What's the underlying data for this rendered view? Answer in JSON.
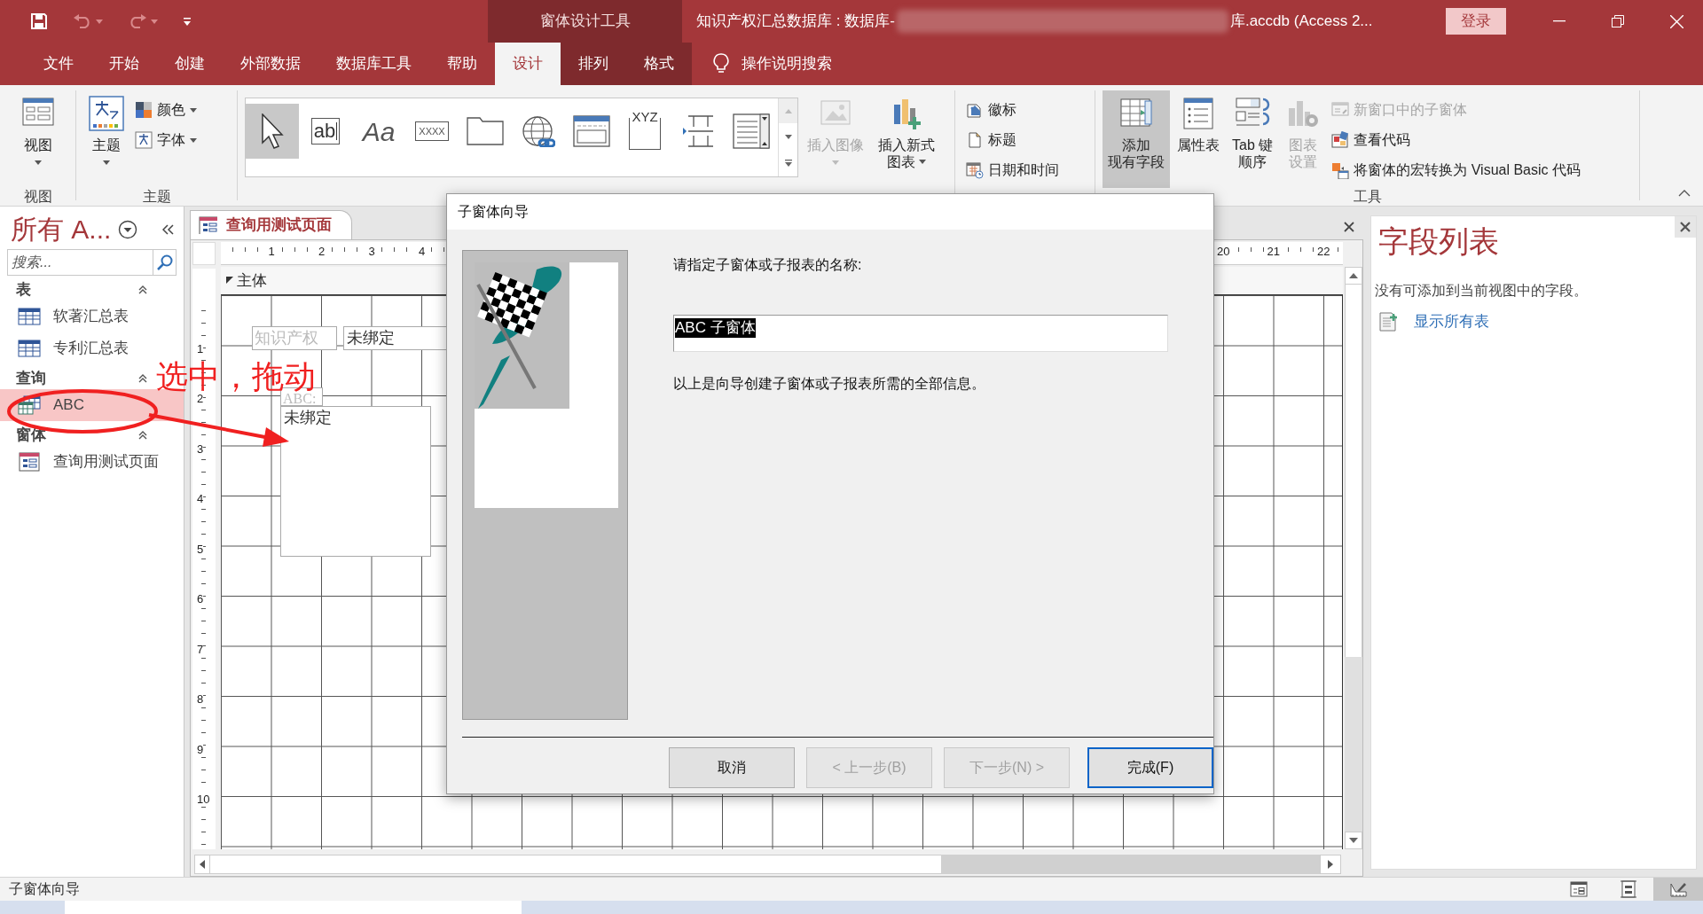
{
  "title_bar": {
    "context_group": "窗体设计工具",
    "title_start": "知识产权汇总数据库 : 数据库-",
    "title_end": "库.accdb (Access 2...",
    "sign_in": "登录"
  },
  "ribbon_tabs": [
    {
      "label": "文件",
      "selected": false
    },
    {
      "label": "开始",
      "selected": false
    },
    {
      "label": "创建",
      "selected": false
    },
    {
      "label": "外部数据",
      "selected": false
    },
    {
      "label": "数据库工具",
      "selected": false
    },
    {
      "label": "帮助",
      "selected": false
    },
    {
      "label": "设计",
      "selected": true
    },
    {
      "label": "排列",
      "selected": false
    },
    {
      "label": "格式",
      "selected": false
    }
  ],
  "tell_me": "操作说明搜索",
  "ribbon_groups": [
    {
      "label": "视图",
      "items": [
        {
          "kind": "large",
          "lines": [
            "视图"
          ],
          "dropdown": true,
          "disabled": false,
          "pressed": false
        }
      ]
    },
    {
      "label": "主题",
      "items": [
        {
          "kind": "large",
          "lines": [
            "主题"
          ],
          "dropdown": true,
          "disabled": false,
          "pressed": false
        },
        {
          "kind": "stack",
          "entries": [
            {
              "label": "颜色",
              "dropdown": true,
              "disabled": false
            },
            {
              "label": "字体",
              "dropdown": true,
              "disabled": false
            }
          ]
        }
      ]
    },
    {
      "items": [
        {
          "kind": "gallery",
          "entries": [
            {
              "selected": true
            },
            {
              "glyph": "ab",
              "selected": false
            },
            {
              "glyph": "Aa",
              "selected": false
            },
            {
              "glyph": "XXXX",
              "selected": false
            },
            {
              "selected": false
            },
            {
              "selected": false
            },
            {
              "selected": false
            },
            {
              "glyph": "XYZ",
              "selected": false
            },
            {
              "selected": false
            },
            {
              "selected": false
            }
          ]
        },
        {
          "kind": "large",
          "lines": [
            "插入图像"
          ],
          "dropdown": true,
          "disabled": true,
          "pressed": false
        },
        {
          "kind": "large",
          "lines": [
            "插入新式",
            "图表"
          ],
          "dropdown": true,
          "disabled": false,
          "pressed": false
        }
      ]
    },
    {
      "items": [
        {
          "kind": "stack",
          "entries": [
            {
              "label": "徽标",
              "dropdown": false,
              "disabled": false
            },
            {
              "label": "标题",
              "dropdown": false,
              "disabled": false
            },
            {
              "label": "日期和时间",
              "dropdown": false,
              "disabled": false
            }
          ]
        }
      ]
    },
    {
      "label": "工具",
      "items": [
        {
          "kind": "large",
          "lines": [
            "添加",
            "现有字段"
          ],
          "dropdown": false,
          "disabled": false,
          "pressed": true
        },
        {
          "kind": "large",
          "lines": [
            "属性表"
          ],
          "dropdown": false,
          "disabled": false,
          "pressed": false
        },
        {
          "kind": "large",
          "lines": [
            "Tab 键",
            "顺序"
          ],
          "dropdown": false,
          "disabled": false,
          "pressed": false
        },
        {
          "kind": "large",
          "lines": [
            "图表",
            "设置"
          ],
          "dropdown": false,
          "disabled": true,
          "pressed": false
        },
        {
          "kind": "stack",
          "entries": [
            {
              "label": "新窗口中的子窗体",
              "dropdown": false,
              "disabled": true
            },
            {
              "label": "查看代码",
              "dropdown": false,
              "disabled": false
            },
            {
              "label": "将窗体的宏转换为 Visual Basic 代码",
              "dropdown": false,
              "disabled": false
            }
          ]
        }
      ]
    }
  ],
  "nav_pane": {
    "title": "所有 A...",
    "search_placeholder": "搜索...",
    "groups": [
      {
        "label": "表",
        "kind": "table",
        "expanded": true,
        "items": [
          {
            "label": "软著汇总表",
            "selected": false
          },
          {
            "label": "专利汇总表",
            "selected": false
          }
        ]
      },
      {
        "label": "查询",
        "kind": "query",
        "expanded": true,
        "items": [
          {
            "label": "ABC",
            "selected": true
          }
        ]
      },
      {
        "label": "窗体",
        "kind": "form",
        "expanded": true,
        "items": [
          {
            "label": "查询用测试页面",
            "selected": false
          }
        ]
      }
    ]
  },
  "document": {
    "tab": "查询用测试页面",
    "ruler_start": [
      "1",
      "2",
      "3",
      "4"
    ],
    "ruler_end": [
      "20",
      "21",
      "22"
    ],
    "ruler_side": [
      "1",
      "2",
      "3",
      "4",
      "5",
      "6",
      "7",
      "8",
      "9",
      "10"
    ],
    "section": "主体",
    "controls": [
      {
        "kind": "label",
        "text": "知识产权"
      },
      {
        "kind": "textbox",
        "text": "未绑定"
      },
      {
        "kind": "label",
        "text": "ABC:"
      },
      {
        "kind": "subform",
        "text": "未绑定"
      }
    ]
  },
  "annotation": {
    "text": "选中，拖动"
  },
  "dialog": {
    "title": "子窗体向导",
    "prompt": "请指定子窗体或子报表的名称:",
    "name_value": "ABC 子窗体",
    "info": "以上是向导创建子窗体或子报表所需的全部信息。",
    "buttons": [
      {
        "label": "取消",
        "disabled": false,
        "default": false
      },
      {
        "label": "< 上一步(B)",
        "disabled": true,
        "default": false
      },
      {
        "label": "下一步(N) >",
        "disabled": true,
        "default": false
      },
      {
        "label": "完成(F)",
        "disabled": false,
        "default": true
      }
    ]
  },
  "field_list": {
    "title": "字段列表",
    "message": "没有可添加到当前视图中的字段。",
    "link": "显示所有表"
  },
  "status_bar": {
    "text": "子窗体向导",
    "views": [
      {
        "selected": false
      },
      {
        "selected": false
      },
      {
        "selected": true
      }
    ]
  }
}
